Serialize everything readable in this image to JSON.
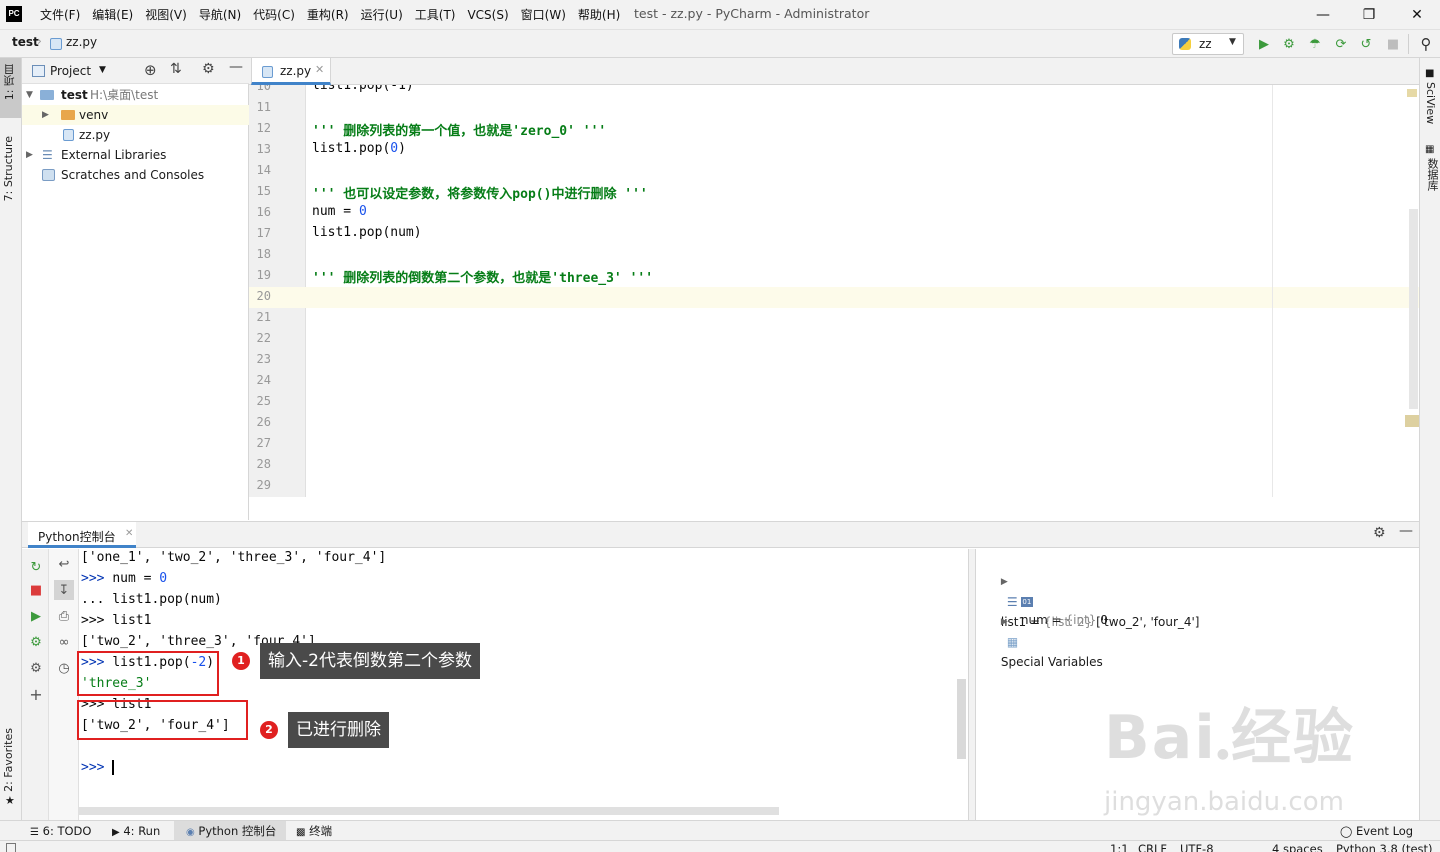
{
  "app": {
    "logo_text": "PC",
    "menu": [
      "文件(F)",
      "编辑(E)",
      "视图(V)",
      "导航(N)",
      "代码(C)",
      "重构(R)",
      "运行(U)",
      "工具(T)",
      "VCS(S)",
      "窗口(W)",
      "帮助(H)"
    ],
    "window_title": "test - zz.py - PyCharm - Administrator"
  },
  "navbar": {
    "project": "test",
    "file": "zz.py",
    "run_config": "zz"
  },
  "left_strip": {
    "project_tab": "1: 项目",
    "structure_tab": "7: Structure",
    "favorites_tab": "2: Favorites"
  },
  "right_strip": {
    "sciview_tab": "SciView",
    "database_tab": "数据库"
  },
  "project_panel": {
    "title": "Project",
    "root_name": "test",
    "root_path": "H:\\桌面\\test",
    "items": [
      "venv",
      "zz.py",
      "External Libraries",
      "Scratches and Consoles"
    ]
  },
  "editor": {
    "tab_label": "zz.py",
    "line_numbers": [
      "10",
      "11",
      "12",
      "13",
      "14",
      "15",
      "16",
      "17",
      "18",
      "19",
      "20",
      "21",
      "22",
      "23",
      "24",
      "25",
      "26",
      "27",
      "28",
      "29"
    ],
    "code": {
      "l10": "list1.pop(-1)",
      "l12_doc": "''' 删除列表的第一个值，也就是'zero_0' '''",
      "l13_a": "list1.pop(",
      "l13_num": "0",
      "l13_b": ")",
      "l15_doc": "''' 也可以设定参数，将参数传入pop()中进行删除 '''",
      "l16_a": "num = ",
      "l16_num": "0",
      "l17": "list1.pop(num)",
      "l19_doc": "''' 删除列表的倒数第二个参数，也就是'three_3' '''"
    }
  },
  "console": {
    "tab_label": "Python控制台",
    "lines": {
      "c1": "['one_1', 'two_2', 'three_3', 'four_4']",
      "c2_prompt": ">>> ",
      "c2_a": "num = ",
      "c2_num": "0",
      "c3": "... list1.pop(num)",
      "c4": ">>> list1",
      "c5": "['two_2', 'three_3', 'four_4']",
      "c6_prompt": ">>> ",
      "c6_a": "list1.pop(",
      "c6_num": "-2",
      "c6_b": ")",
      "c7": "'three_3'",
      "c8": ">>> list1",
      "c9": "['two_2', 'four_4']",
      "c10": ">>> "
    },
    "variables": [
      {
        "name": "list1",
        "type": "{list: 2}",
        "value": "['two_2', 'four_4']"
      },
      {
        "name": "num",
        "type": "{int}",
        "value": "0"
      },
      {
        "name": "Special Variables",
        "type": "",
        "value": ""
      }
    ]
  },
  "annotations": {
    "badge1": "1",
    "tip1": "输入-2代表倒数第二个参数",
    "badge2": "2",
    "tip2": "已进行删除",
    "highlight_color": "#e02020"
  },
  "bottom_tabs": {
    "todo": "6: TODO",
    "run": "4: Run",
    "python_console": "Python 控制台",
    "terminal": "终端",
    "event_log": "Event Log"
  },
  "status": {
    "position": "1:1",
    "line_sep": "CRLF",
    "encoding": "UTF-8",
    "indent": "4 spaces",
    "interpreter": "Python 3.8 (test)"
  },
  "watermark": {
    "brand": "Bai",
    "brand2": "经验",
    "url": "jingyan.baidu.com"
  },
  "colors": {
    "accent": "#4083c9",
    "docstring": "#067d17",
    "number": "#1750eb",
    "run_green": "#3c9a3c",
    "stop_red": "#db3b3b"
  }
}
